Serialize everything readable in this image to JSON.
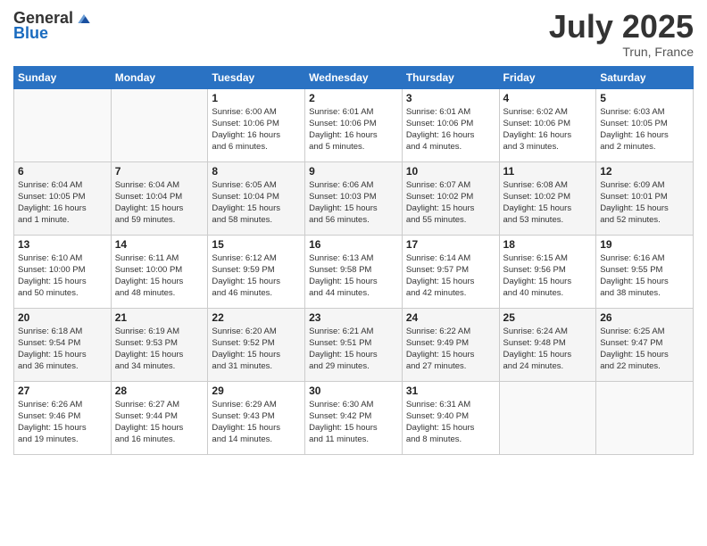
{
  "logo": {
    "text_general": "General",
    "text_blue": "Blue"
  },
  "header": {
    "month": "July 2025",
    "location": "Trun, France"
  },
  "weekdays": [
    "Sunday",
    "Monday",
    "Tuesday",
    "Wednesday",
    "Thursday",
    "Friday",
    "Saturday"
  ],
  "rows": [
    {
      "cells": [
        {
          "day": "",
          "info": ""
        },
        {
          "day": "",
          "info": ""
        },
        {
          "day": "1",
          "info": "Sunrise: 6:00 AM\nSunset: 10:06 PM\nDaylight: 16 hours\nand 6 minutes."
        },
        {
          "day": "2",
          "info": "Sunrise: 6:01 AM\nSunset: 10:06 PM\nDaylight: 16 hours\nand 5 minutes."
        },
        {
          "day": "3",
          "info": "Sunrise: 6:01 AM\nSunset: 10:06 PM\nDaylight: 16 hours\nand 4 minutes."
        },
        {
          "day": "4",
          "info": "Sunrise: 6:02 AM\nSunset: 10:06 PM\nDaylight: 16 hours\nand 3 minutes."
        },
        {
          "day": "5",
          "info": "Sunrise: 6:03 AM\nSunset: 10:05 PM\nDaylight: 16 hours\nand 2 minutes."
        }
      ]
    },
    {
      "cells": [
        {
          "day": "6",
          "info": "Sunrise: 6:04 AM\nSunset: 10:05 PM\nDaylight: 16 hours\nand 1 minute."
        },
        {
          "day": "7",
          "info": "Sunrise: 6:04 AM\nSunset: 10:04 PM\nDaylight: 15 hours\nand 59 minutes."
        },
        {
          "day": "8",
          "info": "Sunrise: 6:05 AM\nSunset: 10:04 PM\nDaylight: 15 hours\nand 58 minutes."
        },
        {
          "day": "9",
          "info": "Sunrise: 6:06 AM\nSunset: 10:03 PM\nDaylight: 15 hours\nand 56 minutes."
        },
        {
          "day": "10",
          "info": "Sunrise: 6:07 AM\nSunset: 10:02 PM\nDaylight: 15 hours\nand 55 minutes."
        },
        {
          "day": "11",
          "info": "Sunrise: 6:08 AM\nSunset: 10:02 PM\nDaylight: 15 hours\nand 53 minutes."
        },
        {
          "day": "12",
          "info": "Sunrise: 6:09 AM\nSunset: 10:01 PM\nDaylight: 15 hours\nand 52 minutes."
        }
      ]
    },
    {
      "cells": [
        {
          "day": "13",
          "info": "Sunrise: 6:10 AM\nSunset: 10:00 PM\nDaylight: 15 hours\nand 50 minutes."
        },
        {
          "day": "14",
          "info": "Sunrise: 6:11 AM\nSunset: 10:00 PM\nDaylight: 15 hours\nand 48 minutes."
        },
        {
          "day": "15",
          "info": "Sunrise: 6:12 AM\nSunset: 9:59 PM\nDaylight: 15 hours\nand 46 minutes."
        },
        {
          "day": "16",
          "info": "Sunrise: 6:13 AM\nSunset: 9:58 PM\nDaylight: 15 hours\nand 44 minutes."
        },
        {
          "day": "17",
          "info": "Sunrise: 6:14 AM\nSunset: 9:57 PM\nDaylight: 15 hours\nand 42 minutes."
        },
        {
          "day": "18",
          "info": "Sunrise: 6:15 AM\nSunset: 9:56 PM\nDaylight: 15 hours\nand 40 minutes."
        },
        {
          "day": "19",
          "info": "Sunrise: 6:16 AM\nSunset: 9:55 PM\nDaylight: 15 hours\nand 38 minutes."
        }
      ]
    },
    {
      "cells": [
        {
          "day": "20",
          "info": "Sunrise: 6:18 AM\nSunset: 9:54 PM\nDaylight: 15 hours\nand 36 minutes."
        },
        {
          "day": "21",
          "info": "Sunrise: 6:19 AM\nSunset: 9:53 PM\nDaylight: 15 hours\nand 34 minutes."
        },
        {
          "day": "22",
          "info": "Sunrise: 6:20 AM\nSunset: 9:52 PM\nDaylight: 15 hours\nand 31 minutes."
        },
        {
          "day": "23",
          "info": "Sunrise: 6:21 AM\nSunset: 9:51 PM\nDaylight: 15 hours\nand 29 minutes."
        },
        {
          "day": "24",
          "info": "Sunrise: 6:22 AM\nSunset: 9:49 PM\nDaylight: 15 hours\nand 27 minutes."
        },
        {
          "day": "25",
          "info": "Sunrise: 6:24 AM\nSunset: 9:48 PM\nDaylight: 15 hours\nand 24 minutes."
        },
        {
          "day": "26",
          "info": "Sunrise: 6:25 AM\nSunset: 9:47 PM\nDaylight: 15 hours\nand 22 minutes."
        }
      ]
    },
    {
      "cells": [
        {
          "day": "27",
          "info": "Sunrise: 6:26 AM\nSunset: 9:46 PM\nDaylight: 15 hours\nand 19 minutes."
        },
        {
          "day": "28",
          "info": "Sunrise: 6:27 AM\nSunset: 9:44 PM\nDaylight: 15 hours\nand 16 minutes."
        },
        {
          "day": "29",
          "info": "Sunrise: 6:29 AM\nSunset: 9:43 PM\nDaylight: 15 hours\nand 14 minutes."
        },
        {
          "day": "30",
          "info": "Sunrise: 6:30 AM\nSunset: 9:42 PM\nDaylight: 15 hours\nand 11 minutes."
        },
        {
          "day": "31",
          "info": "Sunrise: 6:31 AM\nSunset: 9:40 PM\nDaylight: 15 hours\nand 8 minutes."
        },
        {
          "day": "",
          "info": ""
        },
        {
          "day": "",
          "info": ""
        }
      ]
    }
  ]
}
